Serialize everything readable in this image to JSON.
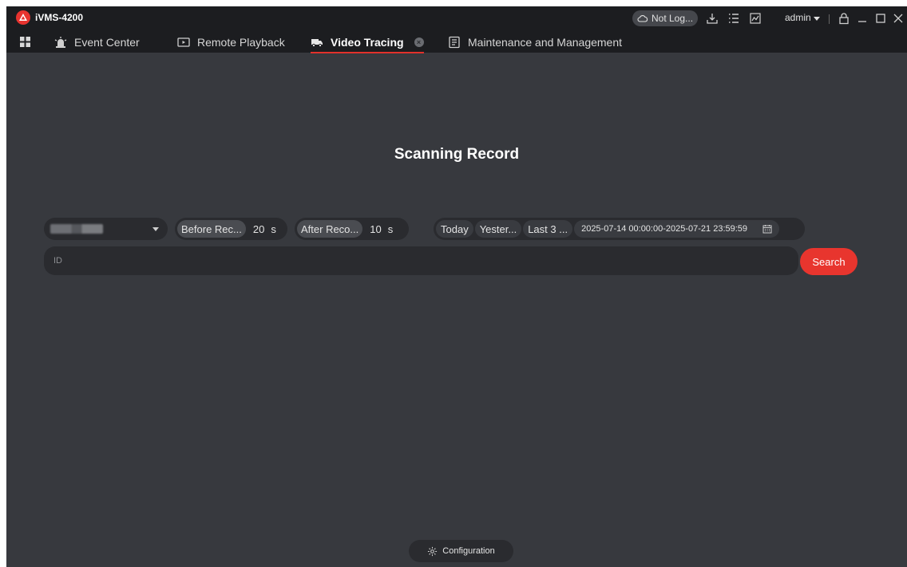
{
  "app": {
    "title": "iVMS-4200"
  },
  "tabs": [
    {
      "label": "Event Center",
      "icon": "alarm-siren-icon",
      "active": false
    },
    {
      "label": "Remote Playback",
      "icon": "playback-icon",
      "active": false
    },
    {
      "label": "Video Tracing",
      "icon": "vehicle-tracing-icon",
      "active": true
    },
    {
      "label": "Maintenance and Management",
      "icon": "maintenance-icon",
      "active": false
    }
  ],
  "header": {
    "login_status": "Not Log...",
    "user": "admin",
    "icons": [
      "cloud-icon",
      "download-icon",
      "task-list-icon",
      "monitor-chart-icon",
      "lock-icon",
      "minimize-icon",
      "maximize-icon",
      "close-icon"
    ]
  },
  "main": {
    "title": "Scanning Record",
    "filters": {
      "before": {
        "label": "Before Rec...",
        "value": "20",
        "unit": "s"
      },
      "after": {
        "label": "After Reco...",
        "value": "10",
        "unit": "s"
      },
      "quick_dates": [
        "Today",
        "Yester...",
        "Last 3 ..."
      ],
      "date_range": "2025-07-14 00:00:00-2025-07-21 23:59:59"
    },
    "search": {
      "placeholder": "ID",
      "value": "",
      "button_label": "Search"
    }
  },
  "footer": {
    "config_label": "Configuration",
    "icon": "gear-icon"
  },
  "colors": {
    "accent": "#e8352e",
    "background": "#37393e",
    "titlebar": "#1c1d20",
    "control": "#2a2b2f"
  }
}
